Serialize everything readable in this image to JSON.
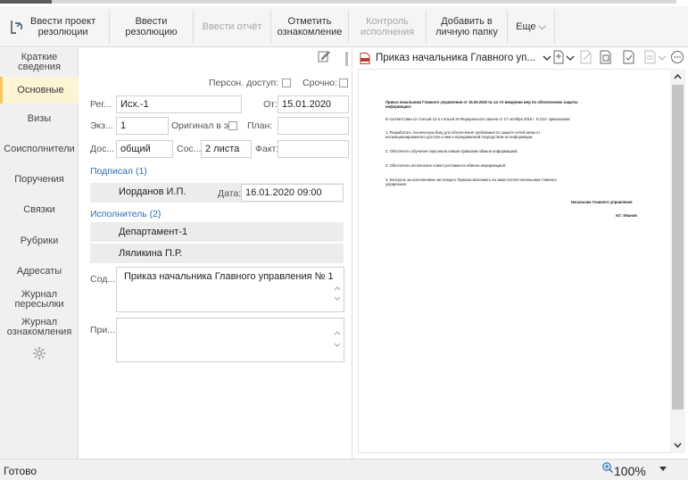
{
  "toolbar": {
    "buttons": [
      {
        "label": "Ввести проект\nрезолюции",
        "enabled": true
      },
      {
        "label": "Ввести\nрезолюцию",
        "enabled": true
      },
      {
        "label": "Ввести отчёт",
        "enabled": false
      },
      {
        "label": "Отметить\nознакомление",
        "enabled": true
      },
      {
        "label": "Контроль\nисполнения",
        "enabled": false
      },
      {
        "label": "Добавить в\nличную папку",
        "enabled": true
      },
      {
        "label": "Еще ⌵",
        "enabled": true
      }
    ]
  },
  "nav": {
    "items": [
      {
        "label": "Краткие\nсведения"
      },
      {
        "label": "Основные"
      },
      {
        "label": "Визы"
      },
      {
        "label": "Соисполнители"
      },
      {
        "label": "Поручения"
      },
      {
        "label": "Связки"
      },
      {
        "label": "Рубрики"
      },
      {
        "label": "Адресаты"
      },
      {
        "label": "Журнал\nпересылки"
      },
      {
        "label": "Журнал\nознакомления"
      }
    ],
    "active_index": 1,
    "settings_icon": "gear-icon"
  },
  "form": {
    "personal_access_label": "Персон. доступ:",
    "urgent_label": "Срочно:",
    "reg_label": "Рег...",
    "reg_value": "Исх.-1",
    "from_label": "От:",
    "from_value": "15.01.2020",
    "copy_label": "Экз...",
    "copy_value": "1",
    "original_label": "Оригинал в э...",
    "plan_label": "План:",
    "plan_value": "",
    "access_label": "Дос...",
    "access_value": "общий",
    "comp_label": "Сос...",
    "comp_value": "2 листа",
    "fact_label": "Факт:",
    "fact_value": "",
    "signed_label": "Подписал (1)",
    "signer_name": "Иорданов И.П.",
    "date_label": "Дата:",
    "date_value": "16.01.2020 09:00",
    "executor_label": "Исполнитель (2)",
    "executors": [
      "Департамент-1",
      "Ляликина П.Р."
    ],
    "content_label": "Сод...",
    "content_value": "Приказ начальника Главного управления № 1",
    "note_label": "При...",
    "note_value": ""
  },
  "viewer": {
    "doc_tab": "Приказ начальника Главного уп...",
    "doc_lines": [
      "Приказ начальника Главного управления от 16.09.2020 № 14 «О введении мер по обеспечению защиты",
      "информации»",
      "В соответствии со статьей 12 и статьей 26 Федерального закона от 17 октября 2019 г. N 210- приказываю:",
      "1. Разработать техническую базу для обеспечения требования по защите сетей связи от",
      "несанкционированного доступа к ним и передаваемой посредством их информации.",
      "2. Обеспечить обучение персонала новым правилам обмена информацией.",
      "3. Обеспечить исполнение нового регламента обмена информацией.",
      "3. Контроль за исполнением настоящего Приказа возложить на заместителя начальника Главного",
      "управления.",
      "Начальник Главного управления",
      "И.Г. Иванов"
    ]
  },
  "status": {
    "text": "Готово",
    "zoom": "100%"
  }
}
